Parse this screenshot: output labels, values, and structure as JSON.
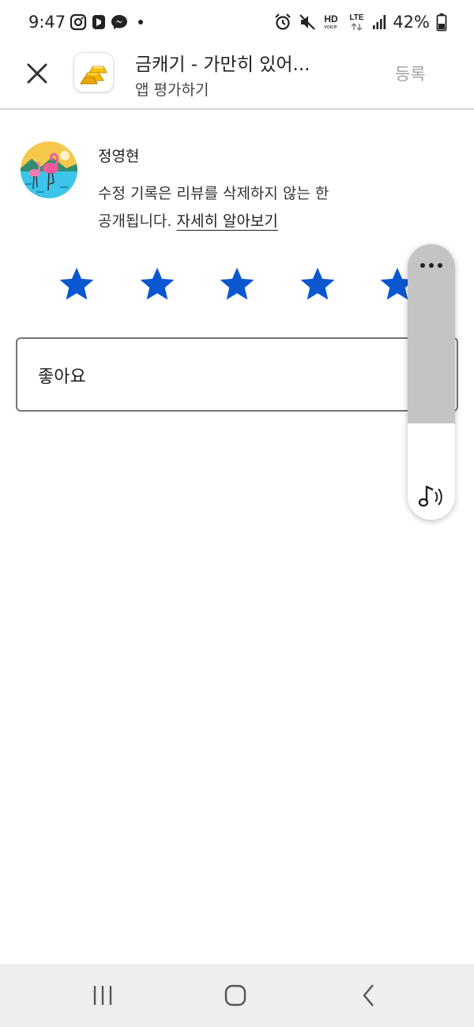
{
  "status_bar": {
    "time": "9:47",
    "battery": "42%",
    "icons": [
      "instagram-icon",
      "b-app-icon",
      "messenger-icon",
      "dot-icon",
      "alarm-icon",
      "mute-icon",
      "hd-voice-icon",
      "lte-icon",
      "signal-icon",
      "battery-icon"
    ],
    "hd_text": "HD",
    "voice_text": "voice",
    "lte_text": "LTE"
  },
  "app_bar": {
    "title": "금캐기 - 가만히 있어...",
    "subtitle": "앱 평가하기",
    "submit_label": "등록",
    "close_icon": "close-icon",
    "app_icon": "gold-bars-icon"
  },
  "user": {
    "name": "정영현",
    "notice_line1": "수정 기록은 리뷰를 삭제하지 않는 한",
    "notice_line2": "공개됩니다. ",
    "learn_more": "자세히 알아보기"
  },
  "rating": {
    "value": 5,
    "max": 5,
    "star_color": "#0b57d0"
  },
  "review": {
    "text": "좋아요"
  },
  "volume_panel": {
    "level": 0.35,
    "more_icon": "more-horizontal-icon",
    "media_icon": "music-note-volume-icon"
  },
  "nav_bar": {
    "items": [
      "recents-icon",
      "home-icon",
      "back-icon"
    ]
  },
  "colors": {
    "accent": "#0b57d0",
    "divider": "#d4d4d4",
    "submit_disabled": "#9aa0a6"
  }
}
